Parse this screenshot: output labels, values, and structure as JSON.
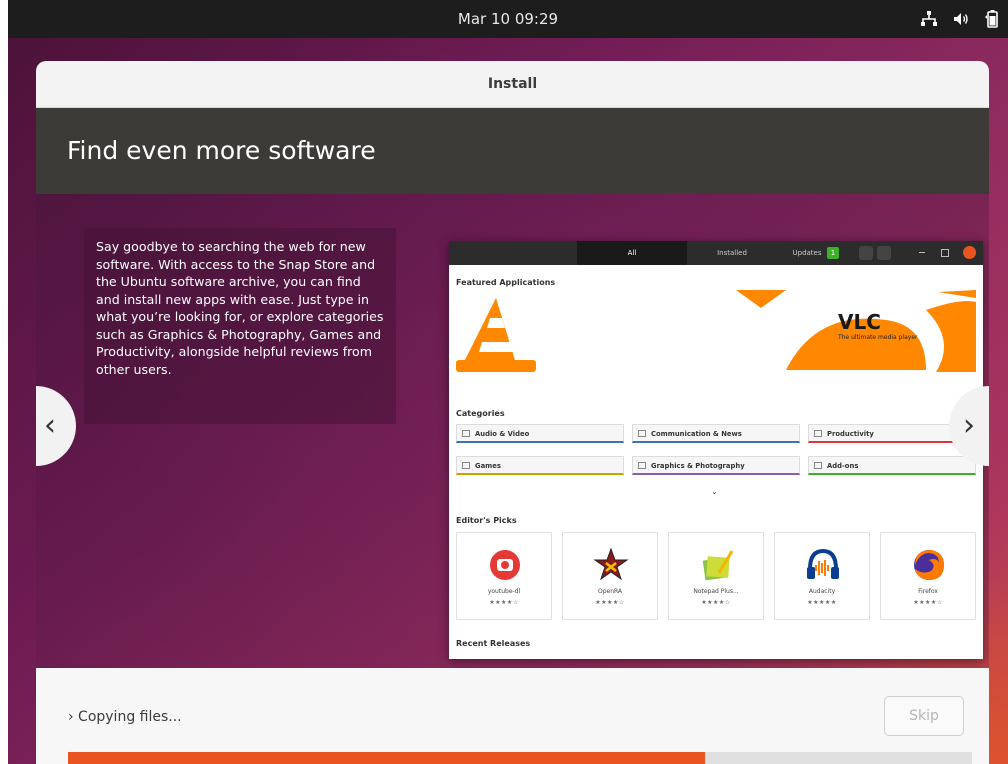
{
  "topbar": {
    "clock": "Mar 10  09:29",
    "tray_icons": [
      "network-icon",
      "volume-icon",
      "battery-icon"
    ]
  },
  "window": {
    "title": "Install"
  },
  "slide": {
    "title": "Find even more software",
    "description": "Say goodbye to searching the web for new software. With access to the Snap Store and the Ubuntu software archive, you can find and install new apps with ease. Just type in what you’re looking for, or explore categories such as Graphics & Photography, Games and Productivity, alongside helpful reviews from other users.",
    "prev_glyph": "‹",
    "next_glyph": "›"
  },
  "mock": {
    "tabs": [
      "All",
      "Installed",
      "Updates"
    ],
    "updates_count": "1",
    "featured_heading": "Featured Applications",
    "banner_title": "VLC",
    "banner_subtitle": "The ultimate media player",
    "categories_heading": "Categories",
    "categories": [
      "Audio & Video",
      "Communication & News",
      "Productivity",
      "Games",
      "Graphics & Photography",
      "Add-ons"
    ],
    "expand_glyph": "⌄",
    "editors_heading": "Editor's Picks",
    "picks": [
      {
        "name": "youtube-dl",
        "stars": "★★★★☆"
      },
      {
        "name": "OpenRA",
        "stars": "★★★★☆"
      },
      {
        "name": "Notepad Plus...",
        "stars": "★★★★☆"
      },
      {
        "name": "Audacity",
        "stars": "★★★★★"
      },
      {
        "name": "Firefox",
        "stars": "★★★★☆"
      }
    ],
    "recent_heading": "Recent Releases"
  },
  "bottom": {
    "status": "› Copying files...",
    "skip_label": "Skip",
    "progress": 0.705
  },
  "colors": {
    "accent": "#e95420",
    "header_dark": "#3c3b37",
    "topbar": "#1d1d1d"
  }
}
